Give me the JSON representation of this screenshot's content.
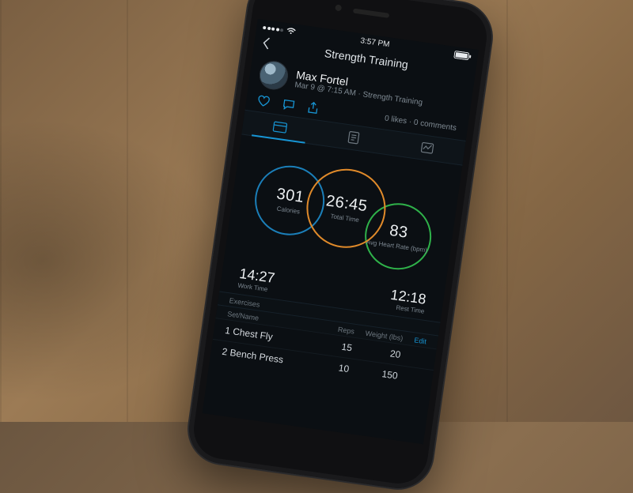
{
  "status": {
    "time": "3:57 PM"
  },
  "nav": {
    "title": "Strength Training"
  },
  "user": {
    "name": "Max Fortel",
    "subtitle": "Mar 9 @ 7:15 AM · Strength Training"
  },
  "social": {
    "stats": "0 likes · 0 comments"
  },
  "metrics": {
    "calories": {
      "value": "301",
      "label": "Calories"
    },
    "totalTime": {
      "value": "26:45",
      "label": "Total Time"
    },
    "avgHeartRate": {
      "value": "83",
      "label": "Avg Heart Rate (bpm)"
    },
    "workTime": {
      "value": "14:27",
      "label": "Work Time"
    },
    "restTime": {
      "value": "12:18",
      "label": "Rest Time"
    }
  },
  "exerciseHeaders": {
    "setName": "Exercises",
    "subhead": "Set/Name",
    "reps": "Reps",
    "weight": "Weight (lbs)",
    "edit": "Edit"
  },
  "exercises": [
    {
      "name": "1 Chest Fly",
      "reps": "15",
      "weight": "20"
    },
    {
      "name": "2 Bench Press",
      "reps": "10",
      "weight": "150"
    }
  ]
}
